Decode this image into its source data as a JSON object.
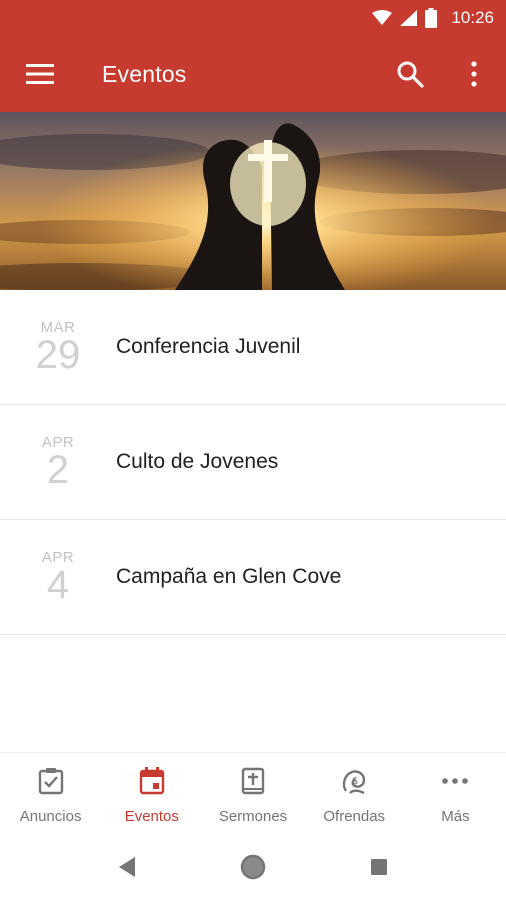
{
  "status_bar": {
    "time": "10:26",
    "icons": [
      "wifi-icon",
      "cell-signal-icon",
      "battery-icon"
    ]
  },
  "app_bar": {
    "title": "Eventos",
    "menu_icon": "hamburger-menu-icon",
    "actions": [
      "search-icon",
      "more-vert-icon"
    ]
  },
  "hero": {
    "description_icon": "hero-image"
  },
  "events": [
    {
      "month": "MAR",
      "day": "29",
      "title": "Conferencia Juvenil"
    },
    {
      "month": "APR",
      "day": "2",
      "title": "Culto de Jovenes"
    },
    {
      "month": "APR",
      "day": "4",
      "title": "Campaña en Glen Cove"
    }
  ],
  "bottom_nav": {
    "items": [
      {
        "label": "Anuncios",
        "icon": "clipboard-check-icon",
        "active": false
      },
      {
        "label": "Eventos",
        "icon": "calendar-icon",
        "active": true
      },
      {
        "label": "Sermones",
        "icon": "bible-icon",
        "active": false
      },
      {
        "label": "Ofrendas",
        "icon": "giving-icon",
        "active": false
      },
      {
        "label": "Más",
        "icon": "more-horiz-icon",
        "active": false
      }
    ]
  },
  "system_nav": {
    "buttons": [
      "back-icon",
      "home-icon",
      "recents-icon"
    ]
  },
  "colors": {
    "primary": "#c63a2f",
    "nav_inactive": "#757575",
    "date_text": "#c2c2c2"
  }
}
